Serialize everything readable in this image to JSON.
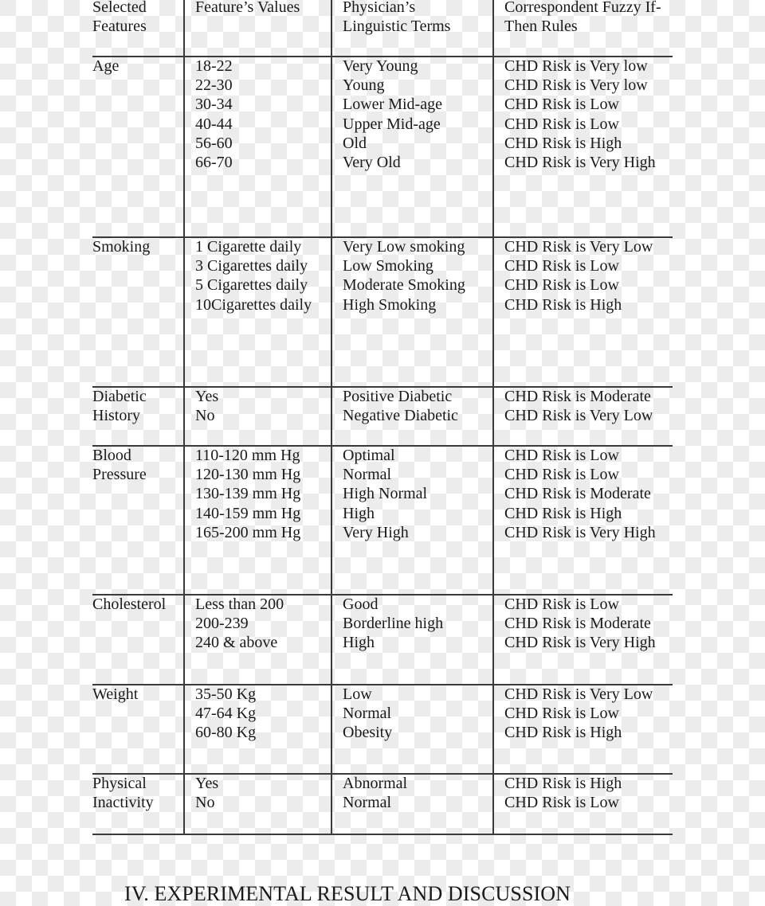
{
  "table": {
    "headers": [
      [
        " Selected",
        "Features"
      ],
      [
        "Feature’s Values"
      ],
      [
        "Physician’s",
        "Linguistic Terms"
      ],
      [
        "Correspondent Fuzzy If-",
        "Then Rules"
      ]
    ],
    "rows": [
      {
        "feature": [
          "Age"
        ],
        "values": [
          "18-22",
          "22-30",
          "30-34",
          "40-44",
          "56-60",
          "66-70"
        ],
        "terms": [
          "Very Young",
          "Young",
          "Lower Mid-age",
          "Upper Mid-age",
          "Old",
          "Very Old"
        ],
        "rules": [
          "CHD Risk is Very low",
          "CHD Risk is Very low",
          "CHD Risk is Low",
          "CHD Risk is Low",
          "CHD Risk is High",
          "CHD Risk is Very High"
        ]
      },
      {
        "feature": [
          "Smoking"
        ],
        "values": [
          "1 Cigarette daily",
          "3 Cigarettes daily",
          "5 Cigarettes daily",
          "10Cigarettes daily"
        ],
        "terms": [
          "Very Low smoking",
          "Low Smoking",
          "Moderate Smoking",
          "High Smoking"
        ],
        "rules": [
          "CHD Risk is Very Low",
          "CHD Risk is Low",
          "CHD Risk is Low",
          "CHD Risk is High"
        ]
      },
      {
        "feature": [
          "Diabetic",
          "History"
        ],
        "values": [
          "Yes",
          "No"
        ],
        "terms": [
          "Positive Diabetic",
          "Negative Diabetic"
        ],
        "rules": [
          "CHD Risk is Moderate",
          "CHD Risk is Very Low"
        ]
      },
      {
        "feature": [
          "Blood",
          "Pressure"
        ],
        "values": [
          "110-120 mm Hg",
          "120-130 mm Hg",
          "130-139 mm Hg",
          "140-159 mm Hg",
          "165-200 mm Hg"
        ],
        "terms": [
          "Optimal",
          "Normal",
          "High Normal",
          "High",
          "Very High"
        ],
        "rules": [
          "CHD Risk is Low",
          "CHD Risk is Low",
          "CHD Risk is Moderate",
          "CHD Risk is High",
          "CHD Risk is Very High"
        ]
      },
      {
        "feature": [
          "Cholesterol"
        ],
        "values": [
          "Less than 200",
          "200-239",
          "240 & above"
        ],
        "terms": [
          "Good",
          "Borderline high",
          "High"
        ],
        "rules": [
          "CHD Risk is Low",
          "CHD Risk is Moderate",
          "CHD Risk is Very High"
        ]
      },
      {
        "feature": [
          "Weight"
        ],
        "values": [
          "35-50 Kg",
          "47-64 Kg",
          "60-80 Kg"
        ],
        "terms": [
          "Low",
          "Normal",
          "Obesity"
        ],
        "rules": [
          "CHD Risk is Very Low",
          "CHD Risk is Low",
          "CHD Risk is High"
        ]
      },
      {
        "feature": [
          "Physical",
          "Inactivity"
        ],
        "values": [
          "Yes",
          "No"
        ],
        "terms": [
          "Abnormal",
          "Normal"
        ],
        "rules": [
          "CHD Risk is High",
          "CHD Risk is Low"
        ]
      }
    ]
  },
  "section_heading": "IV. EXPERIMENTAL RESULT AND DISCUSSION"
}
